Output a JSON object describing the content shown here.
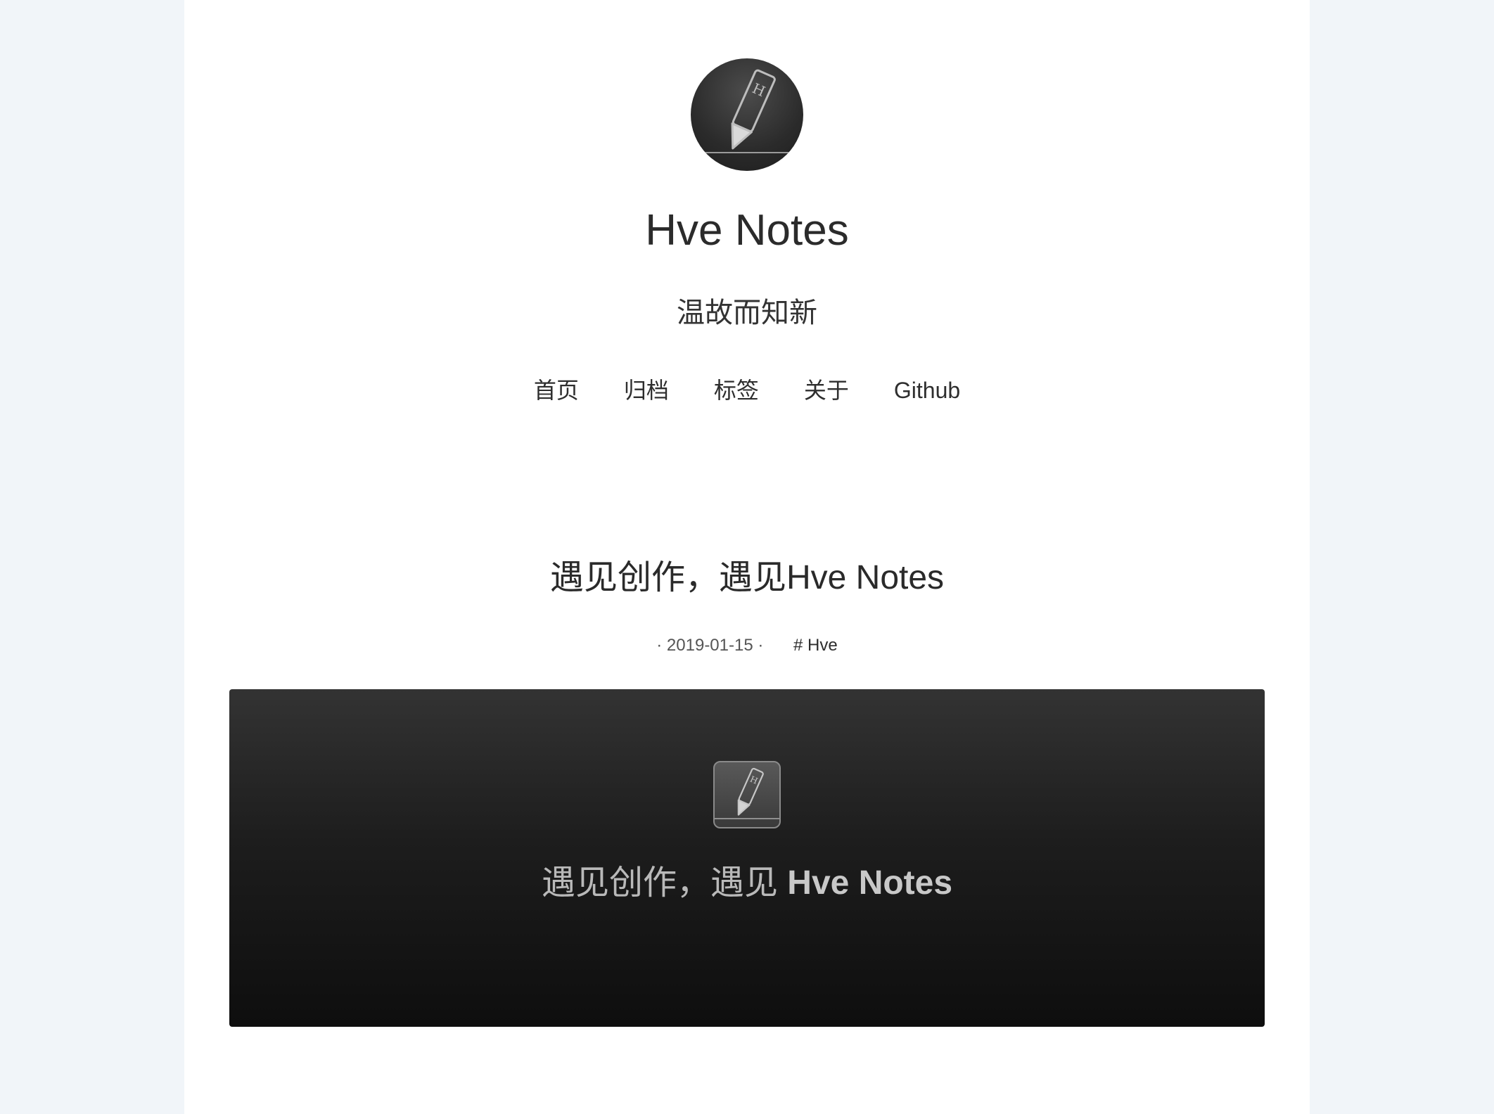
{
  "site": {
    "title": "Hve Notes",
    "subtitle": "温故而知新"
  },
  "nav": {
    "items": [
      {
        "label": "首页"
      },
      {
        "label": "归档"
      },
      {
        "label": "标签"
      },
      {
        "label": "关于"
      },
      {
        "label": "Github"
      }
    ]
  },
  "post": {
    "title": "遇见创作，遇见Hve Notes",
    "date": "· 2019-01-15 ·",
    "tag": "# Hve",
    "feature": {
      "caption_prefix": "遇见创作，遇见 ",
      "caption_brand": "Hve Notes"
    }
  },
  "icons": {
    "avatar": "pencil-icon",
    "feature_logo": "pencil-icon"
  },
  "colors": {
    "page_background": "#f1f5f9",
    "content_background": "#ffffff",
    "text": "#2d2d2d",
    "feature_top": "#333333",
    "feature_bottom": "#0e0e0e"
  }
}
